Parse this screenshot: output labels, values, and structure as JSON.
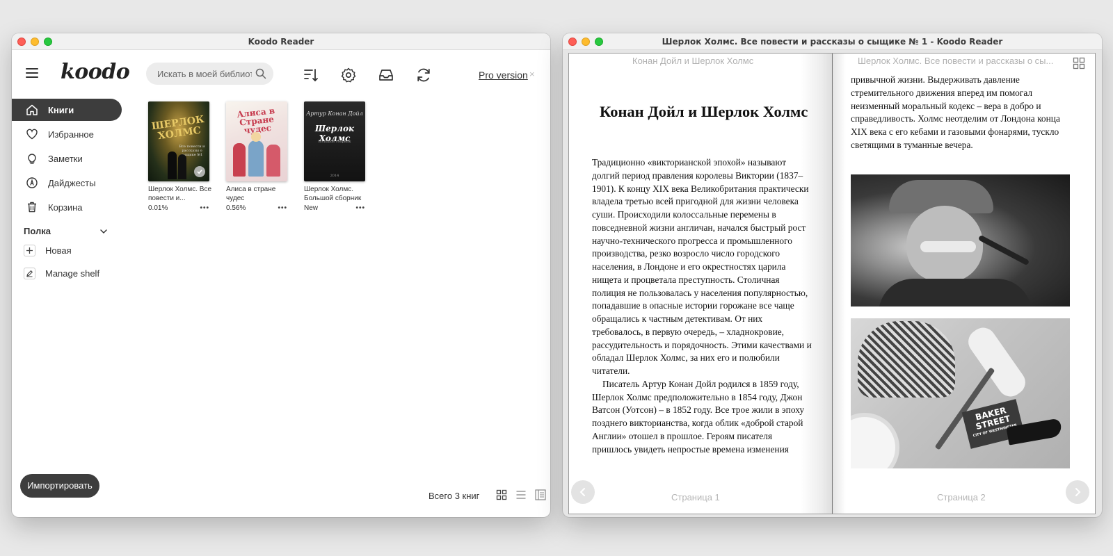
{
  "library": {
    "window_title": "Koodo Reader",
    "logo": "koodo",
    "search_placeholder": "Искать в моей библиотеке",
    "pro_label": "Pro version",
    "pro_close": "×",
    "nav": [
      {
        "label": "Книги"
      },
      {
        "label": "Избранное"
      },
      {
        "label": "Заметки"
      },
      {
        "label": "Дайджесты"
      },
      {
        "label": "Корзина"
      }
    ],
    "shelf_title": "Полка",
    "shelf_new": "Новая",
    "shelf_manage": "Manage shelf",
    "books": [
      {
        "title": "Шерлок Холмс. Все повести и...",
        "progress": "0.01%",
        "cover_title": "ШЕРЛОК ХОЛМС",
        "cover_sub": "Все повести и рассказы о сыщике №1"
      },
      {
        "title": "Алиса в стране чудес",
        "progress": "0.56%",
        "cover_title": "Алиса в Стране чудес"
      },
      {
        "title": "Шерлок Холмс. Большой сборник",
        "progress": "New",
        "cover_author": "Артур Конан Дойл",
        "cover_title": "Шерлок Холмс",
        "cover_sub": "Большой сборник",
        "cover_year": "2014"
      }
    ],
    "dots": "•••",
    "import_label": "Импортировать",
    "total_label": "Всего 3 книг"
  },
  "reader": {
    "window_title": "Шерлок Холмс. Все повести и рассказы о сыщике № 1 - Koodo Reader",
    "left_header": "Конан Дойл и Шерлок Холмс",
    "right_header": "Шерлок Холмс. Все повести и рассказы о сы...",
    "chapter_title": "Конан Дойл и Шерлок Холмс",
    "left_para1": "Традиционно «викторианской эпохой» называют долгий период правления королевы Виктории (1837–1901). К концу XIX века Великобритания практически владела третью всей пригодной для жизни человека суши. Происходили колоссальные перемены в повседневной жизни англичан, начался быстрый рост научно-технического прогресса и промышленного производства, резко возросло число городского населения, в Лондоне и его окрестностях царила нищета и процветала преступность. Столичная полиция не пользовалась у населения популярностью, попадавшие в опасные истории горожане все чаще обращались к частным детективам. От них требовалось, в первую очередь, – хладнокровие, рассудительность и порядочность. Этими качествами и обладал Шерлок Холмс, за них его и полюбили читатели.",
    "left_para2": "Писатель Артур Конан Дойл родился в 1859 году, Шерлок Холмс предположительно в 1854 году, Джон Ватсон (Уотсон) – в 1852 году. Все трое жили в эпоху позднего викторианства, когда облик «доброй старой Англии» отошел в прошлое. Героям писателя пришлось увидеть непростые времена изменения",
    "right_text": "привычной жизни. Выдерживать давление стремительного движения вперед им помогал неизменный моральный кодекс – вера в добро и справедливость. Холмс неотделим от Лондона конца XIX века с его кебами и газовыми фонарями, тускло светящими в туманные вечера.",
    "footer_left": "Страница 1",
    "footer_right": "Страница 2",
    "sign_line1": "BAKER",
    "sign_line2": "STREET",
    "sign_line3": "CITY OF WESTMINSTER"
  }
}
